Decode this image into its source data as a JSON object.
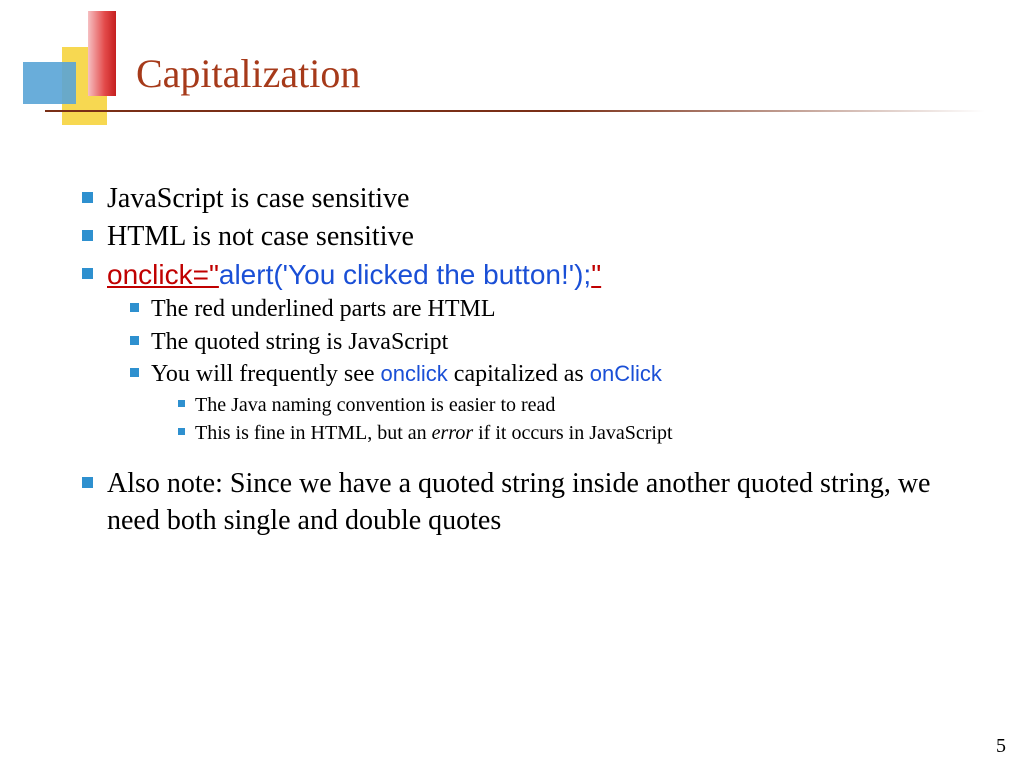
{
  "title": "Capitalization",
  "bullets": {
    "b1": "JavaScript is case sensitive",
    "b2": "HTML is not case sensitive",
    "code_part1": "onclick=\"",
    "code_part2": "alert('You clicked the button!');",
    "code_part3": "\"",
    "s1": "The red underlined parts are HTML",
    "s2": "The quoted string is JavaScript",
    "s3a": "You will frequently see ",
    "s3b": "onclick",
    "s3c": " capitalized as ",
    "s3d": "onClick",
    "ss1": "The Java naming convention is easier to read",
    "ss2a": "This is fine in HTML, but an ",
    "ss2b": "error",
    "ss2c": " if it occurs in JavaScript",
    "b4": "Also note: Since we have a quoted string inside another quoted string, we need both single and double quotes"
  },
  "page_number": "5"
}
